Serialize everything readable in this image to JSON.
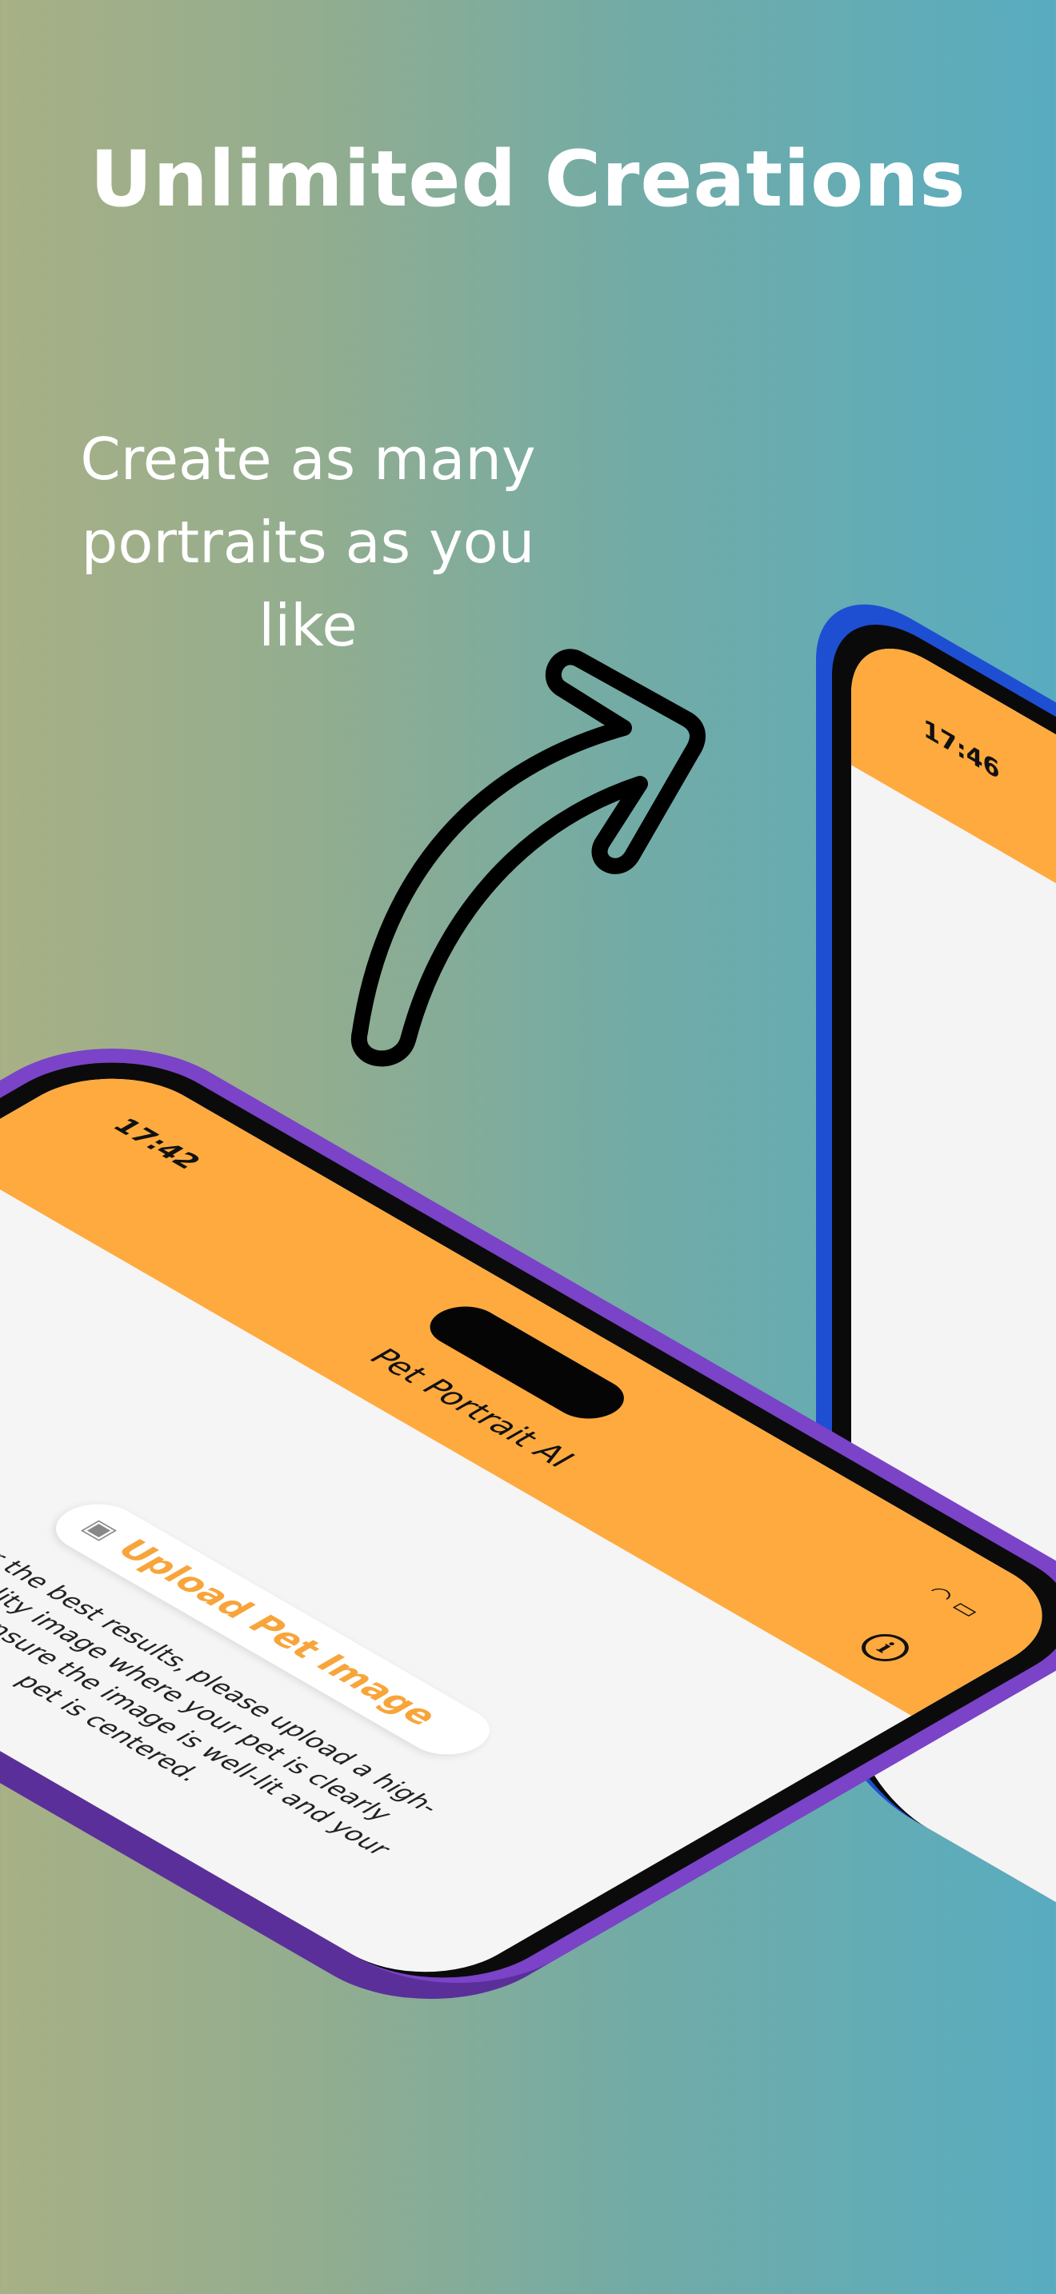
{
  "headline": "Unlimited Creations",
  "subhead": "Create as many portraits as you like",
  "back_phone": {
    "time": "17:46",
    "frame_color": "#1e4fd3"
  },
  "front_phone": {
    "time": "17:42",
    "app_title": "Pet Portrait AI",
    "upload_label": "Upload Pet Image",
    "description": "For the best results, please upload a high-quality image where your pet is clearly visible. Ensure the image is well-lit and your pet is centered.",
    "frame_color": "#7a43c8",
    "header_color": "#ffaa3e",
    "accent_color": "#f7a53b"
  },
  "icons": [
    "curved-arrow-icon",
    "info-icon",
    "wifi-icon",
    "battery-icon",
    "image-upload-icon"
  ]
}
